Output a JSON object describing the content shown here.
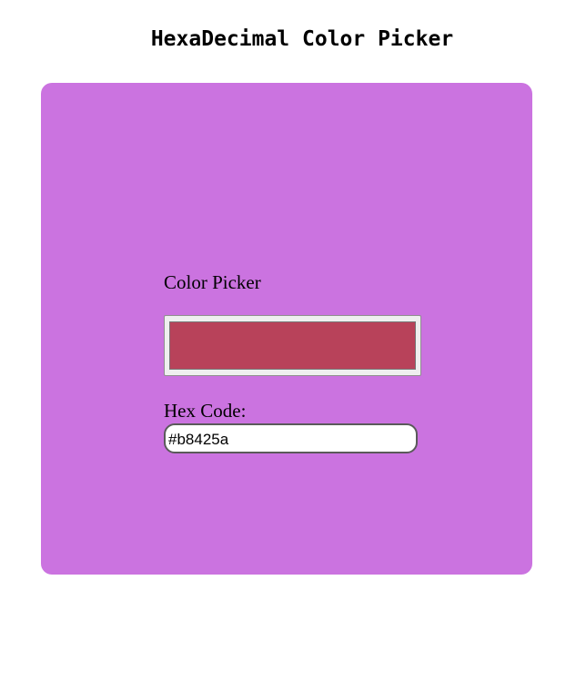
{
  "header": {
    "title": "HexaDecimal Color Picker"
  },
  "panel": {
    "background_color": "#cb73e0"
  },
  "picker": {
    "label": "Color Picker",
    "selected_color": "#b8425a"
  },
  "hex": {
    "label": "Hex Code:",
    "value": "#b8425a"
  }
}
